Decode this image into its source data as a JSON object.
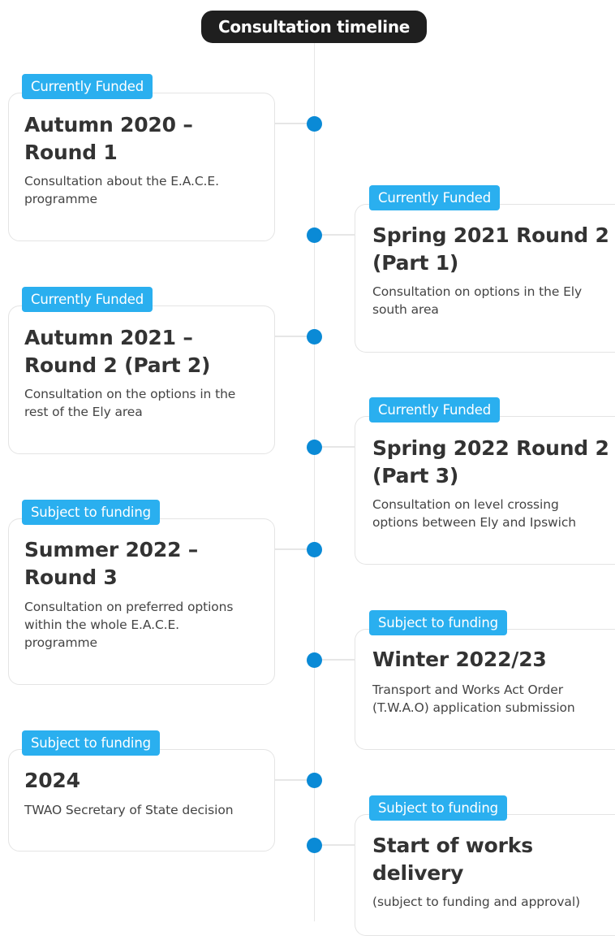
{
  "timeline": {
    "title": "Consultation timeline",
    "items": [
      {
        "status": "Currently Funded",
        "heading_lines": [
          "Autumn 2020 –",
          "Round 1"
        ],
        "description_lines": [
          "Consultation about the E.A.C.E.",
          "programme"
        ]
      },
      {
        "status": "Currently Funded",
        "heading_lines": [
          "Spring 2021 Round 2",
          "(Part 1)"
        ],
        "description_lines": [
          "Consultation on options in the Ely",
          "south area"
        ]
      },
      {
        "status": "Currently Funded",
        "heading_lines": [
          "Autumn 2021 –",
          "Round 2 (Part 2)"
        ],
        "description_lines": [
          "Consultation on the options in the",
          "rest of the Ely area"
        ]
      },
      {
        "status": "Currently Funded",
        "heading_lines": [
          "Spring 2022 Round 2",
          "(Part 3)"
        ],
        "description_lines": [
          "Consultation on level crossing",
          "options between Ely and Ipswich"
        ]
      },
      {
        "status": "Subject to funding",
        "heading_lines": [
          "Summer 2022 –",
          "Round 3"
        ],
        "description_lines": [
          "Consultation on preferred options",
          "within the whole E.A.C.E.",
          "programme"
        ]
      },
      {
        "status": "Subject to funding",
        "heading_lines": [
          "Winter 2022/23"
        ],
        "description_lines": [
          "Transport and Works Act Order",
          "(T.W.A.O) application submission"
        ]
      },
      {
        "status": "Subject to funding",
        "heading_lines": [
          "2024"
        ],
        "description_lines": [
          "TWAO Secretary of State decision"
        ]
      },
      {
        "status": "Subject to funding",
        "heading_lines": [
          "Start of works",
          "delivery"
        ],
        "description_lines": [
          "(subject to funding and approval)"
        ]
      }
    ]
  }
}
